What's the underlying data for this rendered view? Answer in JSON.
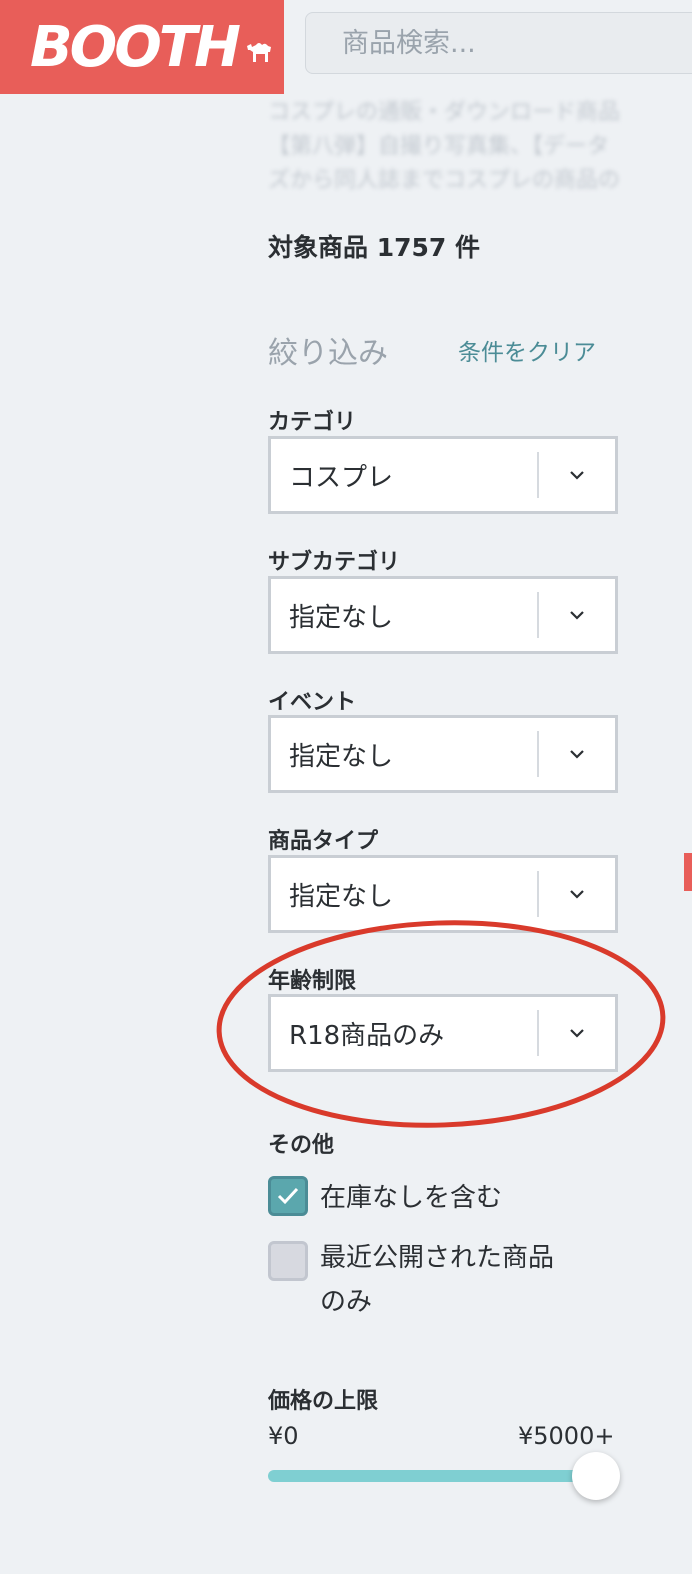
{
  "header": {
    "logo_text": "BOOTH",
    "search_placeholder": "商品検索..."
  },
  "description_lines": [
    "コスプレの通販・ダウンロード商品",
    "【第八弾】自撮り写真集、【データ",
    "ズから同人誌までコスプレの商品の"
  ],
  "result_count": "対象商品 1757 件",
  "filter": {
    "title": "絞り込み",
    "clear_label": "条件をクリア",
    "selects": [
      {
        "label": "カテゴリ",
        "value": "コスプレ"
      },
      {
        "label": "サブカテゴリ",
        "value": "指定なし"
      },
      {
        "label": "イベント",
        "value": "指定なし"
      },
      {
        "label": "商品タイプ",
        "value": "指定なし"
      },
      {
        "label": "年齢制限",
        "value": "R18商品のみ"
      }
    ],
    "other": {
      "label": "その他",
      "checkboxes": [
        {
          "label": "在庫なしを含む",
          "checked": true
        },
        {
          "label_line1": "最近公開された商品",
          "label_line2": "のみ",
          "checked": false
        }
      ]
    },
    "price": {
      "label": "価格の上限",
      "min_label": "¥0",
      "max_label": "¥5000+",
      "slider_value": 1.0
    }
  },
  "colors": {
    "brand": "#e85e59",
    "accent": "#5ba7ad",
    "annotation": "#d93a2b"
  }
}
